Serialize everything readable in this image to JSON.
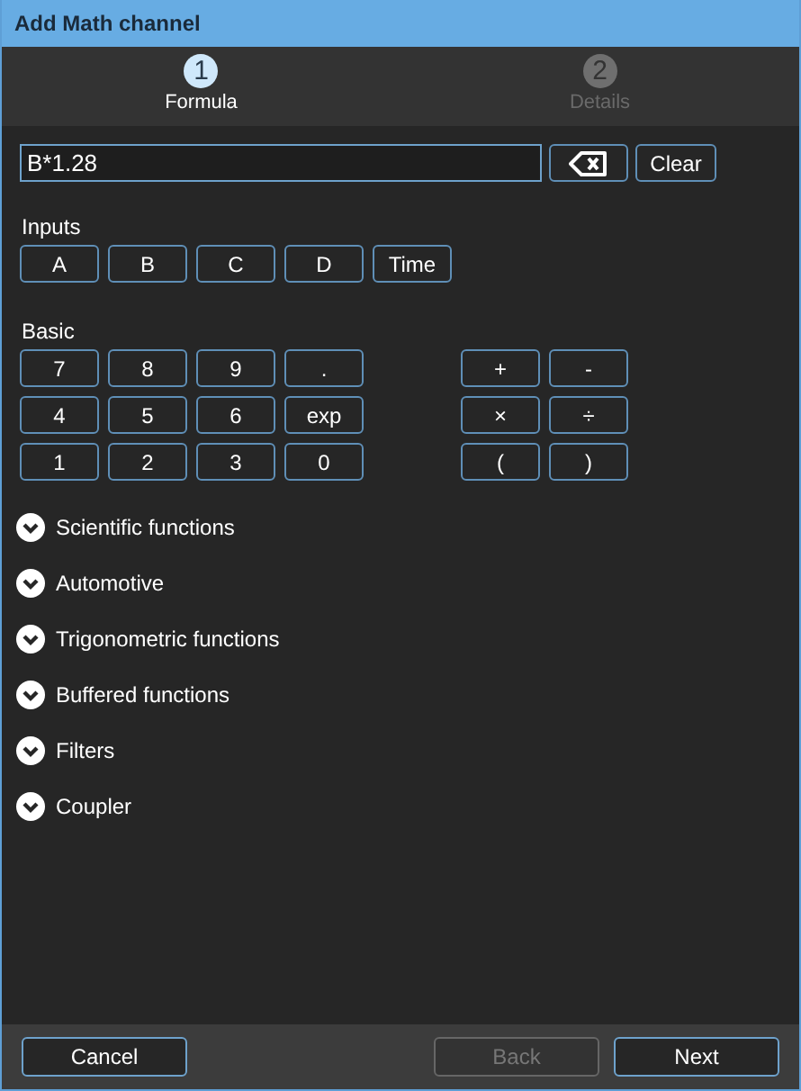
{
  "window": {
    "title": "Add Math channel"
  },
  "steps": [
    {
      "number": "1",
      "label": "Formula",
      "selected": true
    },
    {
      "number": "2",
      "label": "Details",
      "selected": false
    }
  ],
  "formula": {
    "value": "B*1.28",
    "clear_label": "Clear"
  },
  "inputs": {
    "title": "Inputs",
    "buttons": [
      "A",
      "B",
      "C",
      "D",
      "Time"
    ]
  },
  "basic": {
    "title": "Basic",
    "digits": [
      [
        "7",
        "8",
        "9",
        "."
      ],
      [
        "4",
        "5",
        "6",
        "exp"
      ],
      [
        "1",
        "2",
        "3",
        "0"
      ]
    ],
    "operators": [
      [
        "+",
        "-"
      ],
      [
        "×",
        "÷"
      ],
      [
        "(",
        ")"
      ]
    ]
  },
  "sections": [
    {
      "label": "Scientific functions",
      "expanded": false
    },
    {
      "label": "Automotive",
      "expanded": false
    },
    {
      "label": "Trigonometric functions",
      "expanded": false
    },
    {
      "label": "Buffered functions",
      "expanded": false
    },
    {
      "label": "Filters",
      "expanded": false
    },
    {
      "label": "Coupler",
      "expanded": false
    }
  ],
  "footer": {
    "left": [
      {
        "label": "Cancel",
        "disabled": false
      }
    ],
    "right": [
      {
        "label": "Back",
        "disabled": true
      },
      {
        "label": "Next",
        "disabled": false
      }
    ]
  }
}
